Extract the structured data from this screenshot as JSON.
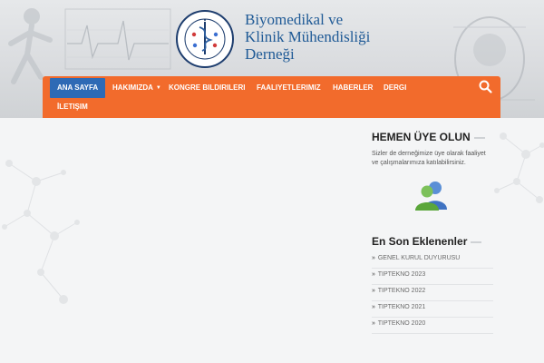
{
  "site": {
    "logo": {
      "title_lines": [
        "Biyomedikal ve",
        "Klinik Mühendisliği",
        "Derneği"
      ],
      "seal_text": "BİYOMEDİKAL ve KLİNİK MÜHENDİSLİĞİ DERNEĞİ",
      "seal_year": "2009"
    }
  },
  "nav": {
    "items": [
      {
        "label": "ANA SAYFA",
        "active": true
      },
      {
        "label": "HAKIMIZDA",
        "has_dropdown": true
      },
      {
        "label": "KONGRE BILDIRILERI"
      },
      {
        "label": "FAALIYETLERIMIZ"
      },
      {
        "label": "HABERLER"
      },
      {
        "label": "DERGI"
      },
      {
        "label": "İLETIŞIM"
      }
    ],
    "search_icon": "search-icon",
    "colors": {
      "bar": "#f26b2c",
      "active": "#2e6ab5"
    }
  },
  "sidebar": {
    "membership": {
      "title": "HEMEN ÜYE OLUN",
      "text": "Sizler de derneğimize üye olarak faaliyet ve çalışmalarımıza katılabilirsiniz.",
      "icon": "users-icon"
    },
    "recent": {
      "title": "En Son Eklenenler",
      "items": [
        "GENEL KURUL DUYURUSU",
        "TIPTEKNO 2023",
        "TIPTEKNO 2022",
        "TIPTEKNO 2021",
        "TIPTEKNO 2020"
      ]
    }
  }
}
